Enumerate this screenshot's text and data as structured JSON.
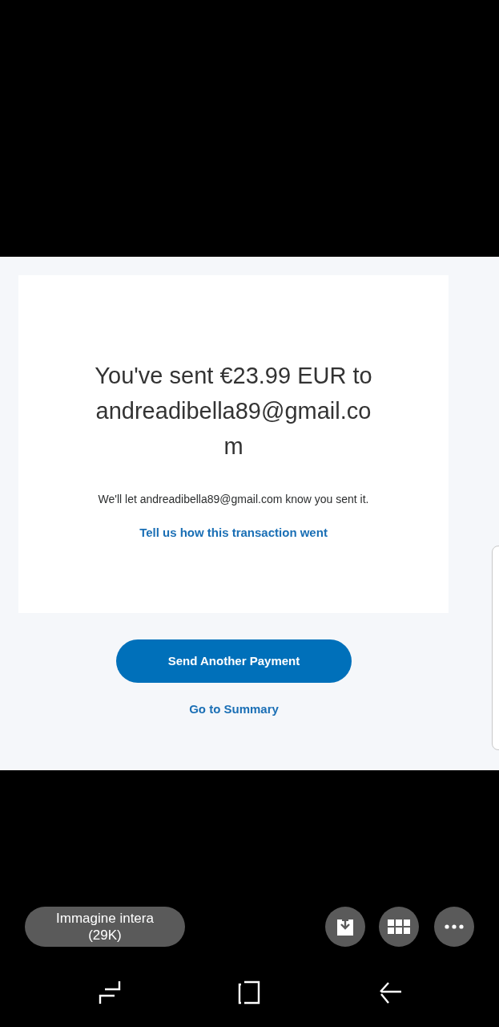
{
  "image": {
    "heading": "You've sent €23.99 EUR to andreadibella89@gmail.com",
    "notice": "We'll let andreadibella89@gmail.com know you sent it.",
    "feedback_link": "Tell us how this transaction went",
    "primary_button": "Send Another Payment",
    "summary_link": "Go to Summary"
  },
  "viewer": {
    "full_image_button": {
      "label": "Immagine intera",
      "size": "(29K)"
    }
  }
}
